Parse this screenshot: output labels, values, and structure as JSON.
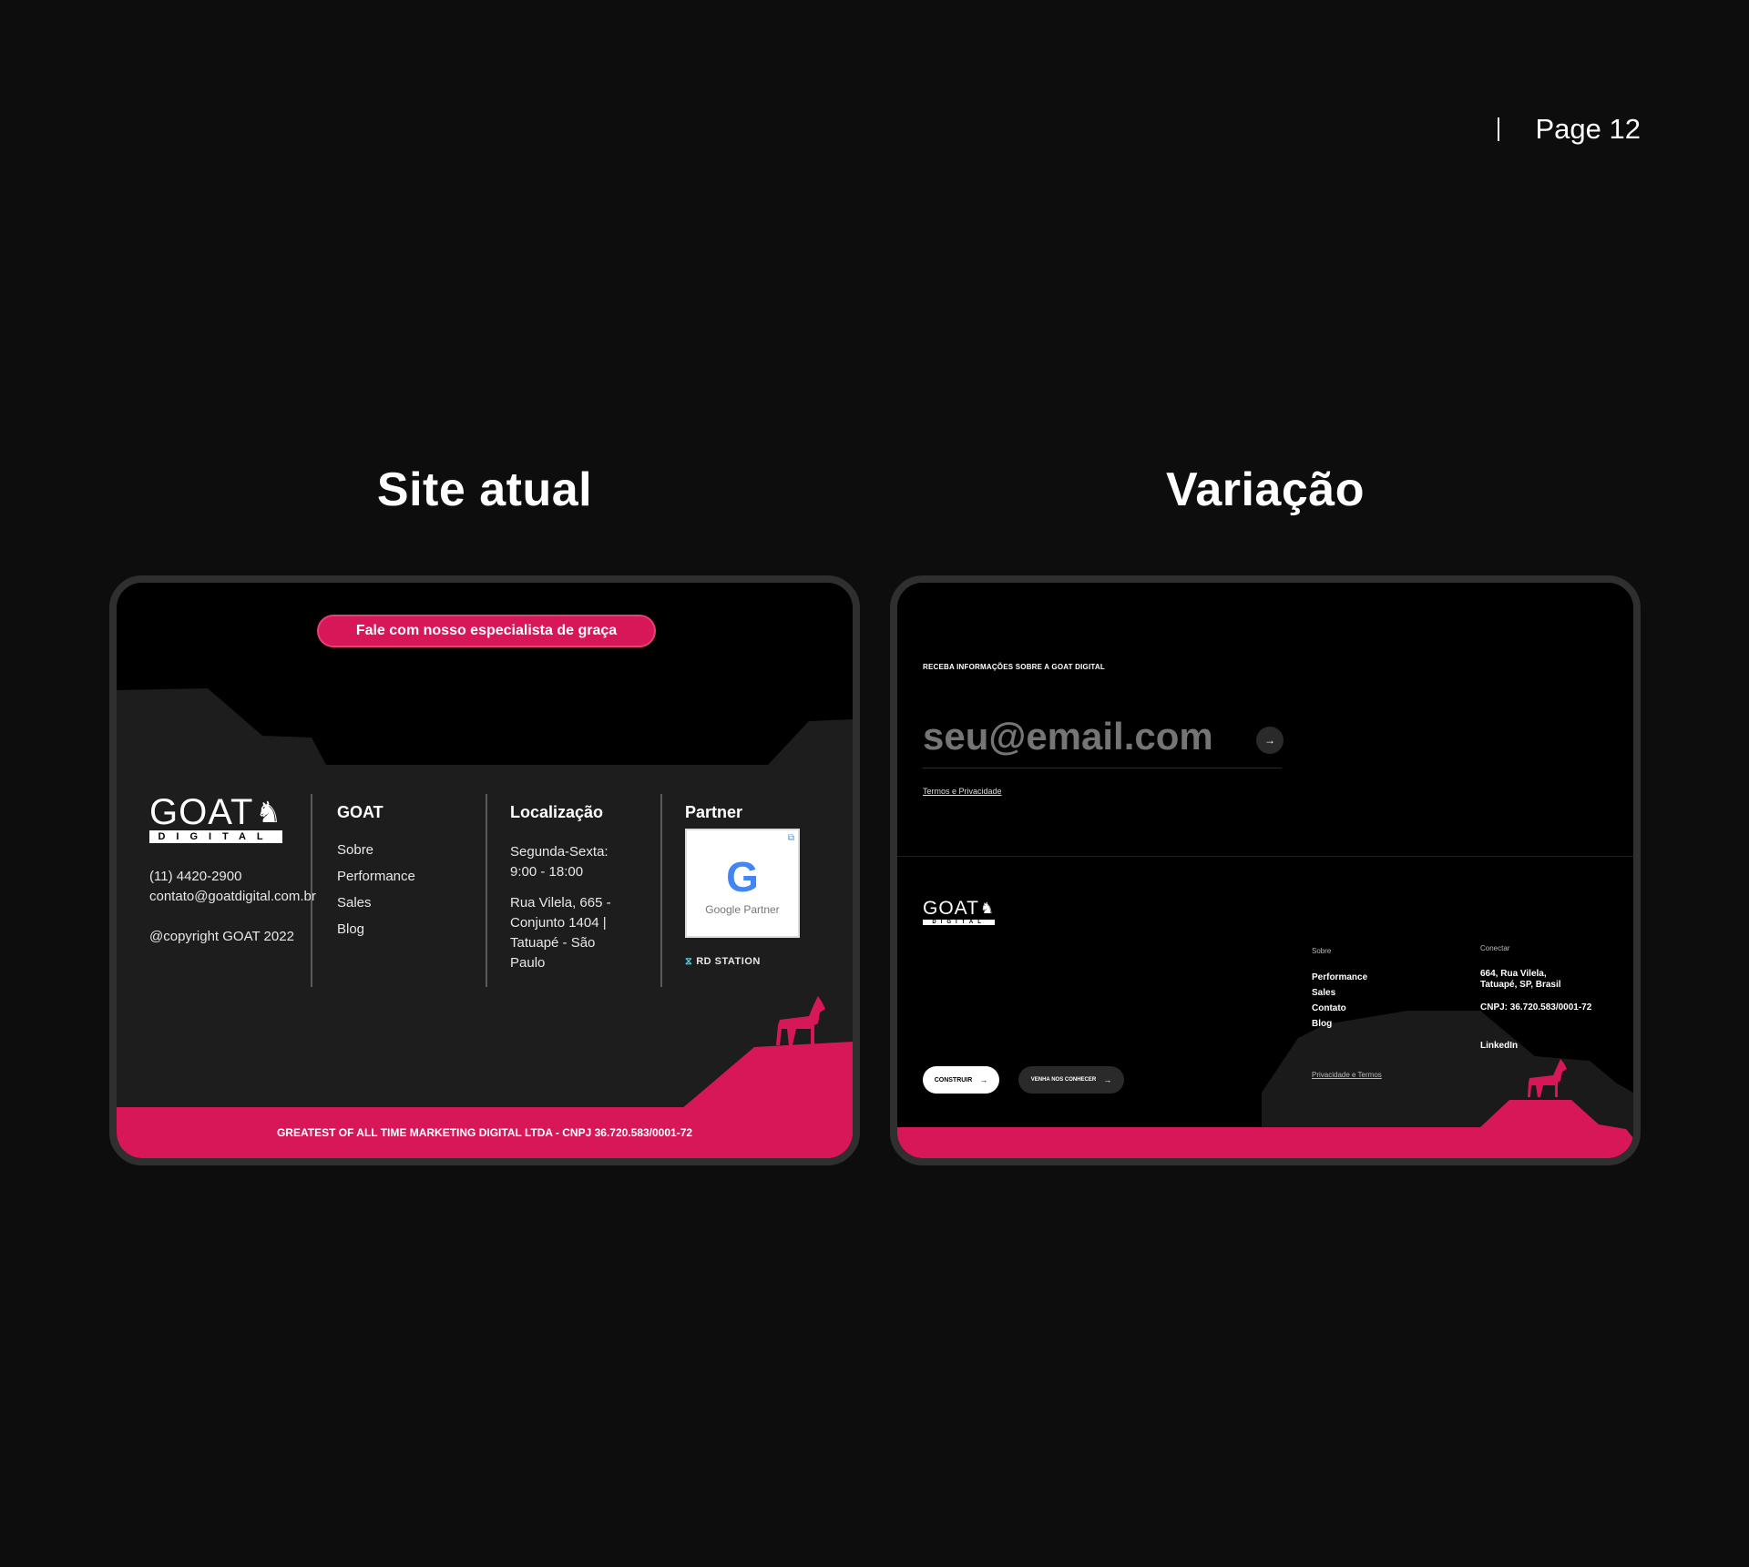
{
  "page_indicator": {
    "label": "Page 12"
  },
  "columns": {
    "left_title": "Site atual",
    "right_title": "Variação"
  },
  "site_atual": {
    "cta": "Fale com nosso especialista de graça",
    "logo": {
      "word": "GOAT",
      "sub": "DIGITAL"
    },
    "phone": "(11) 4420-2900",
    "email": "contato@goatdigital.com.br",
    "copyright": "@copyright GOAT 2022",
    "col_goat": {
      "title": "GOAT",
      "items": [
        "Sobre",
        "Performance",
        "Sales",
        "Blog"
      ]
    },
    "col_local": {
      "title": "Localização",
      "hours": "Segunda-Sexta: 9:00 - 18:00",
      "address": "Rua Vilela, 665 - Conjunto 1404 | Tatuapé - São Paulo"
    },
    "col_partner": {
      "title": "Partner",
      "badge_caption": "Google Partner",
      "badge_letter": "G",
      "rd_label": "RD STATION"
    },
    "footer": "GREATEST OF ALL TIME MARKETING DIGITAL LTDA - CNPJ 36.720.583/0001-72",
    "colors": {
      "accent": "#d81759",
      "panel": "#1d1d1d"
    }
  },
  "variacao": {
    "eyebrow": "RECEBA INFORMAÇÕES SOBRE A GOAT DIGITAL",
    "email_placeholder": "seu@email.com",
    "arrow": "→",
    "terms": "Termos e Privacidade",
    "logo": {
      "word": "GOAT",
      "sub": "DIGITAL"
    },
    "col_sobre": {
      "heading": "Sobre",
      "items": [
        "Performance",
        "Sales",
        "Contato",
        "Blog"
      ]
    },
    "col_conectar": {
      "heading": "Conectar",
      "address_1": "664, Rua Vilela,",
      "address_2": "Tatuapé, SP, Brasil",
      "cnpj": "CNPJ: 36.720.583/0001-72",
      "linkedin": "LinkedIn"
    },
    "privacy": "Privacidade e Termos",
    "btn_construir": "CONSTRUIR",
    "btn_conhecer": "VENHA NOS CONHECER",
    "colors": {
      "accent": "#d81759",
      "mountain": "#1a1a1a"
    }
  }
}
